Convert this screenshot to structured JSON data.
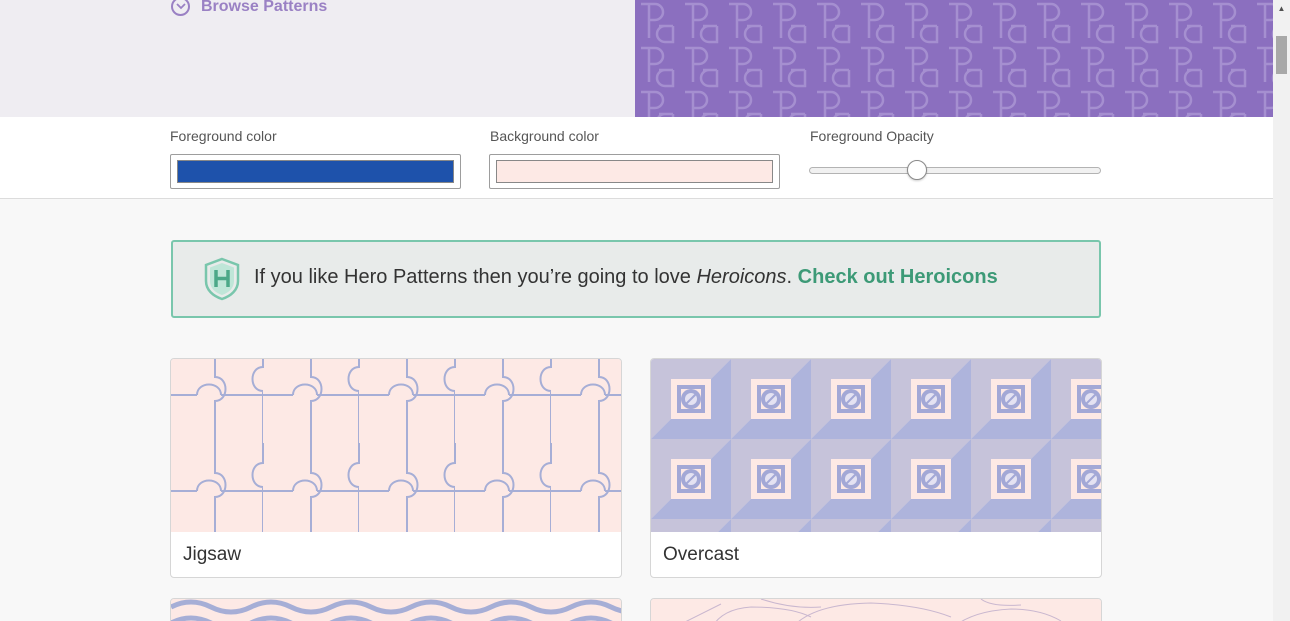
{
  "hero": {
    "browse_label": "Browse Patterns",
    "pattern_color": "#8b6fbf"
  },
  "controls": {
    "foreground_label": "Foreground color",
    "foreground_value": "#1e52ab",
    "background_label": "Background color",
    "background_value": "#fde9e5",
    "opacity_label": "Foreground Opacity",
    "opacity_value": 0.36
  },
  "banner": {
    "text_before": "If you like Hero Patterns then you’re going to love ",
    "text_italic": "Heroicons",
    "text_period": ".",
    "link_label": "Check out Heroicons",
    "accent": "#3d9a77"
  },
  "patterns": [
    {
      "name": "Jigsaw"
    },
    {
      "name": "Overcast"
    },
    {
      "name": ""
    },
    {
      "name": ""
    }
  ],
  "icons": {
    "browse": "chevron-down-circle-icon",
    "banner": "heroicons-shield-logo"
  }
}
